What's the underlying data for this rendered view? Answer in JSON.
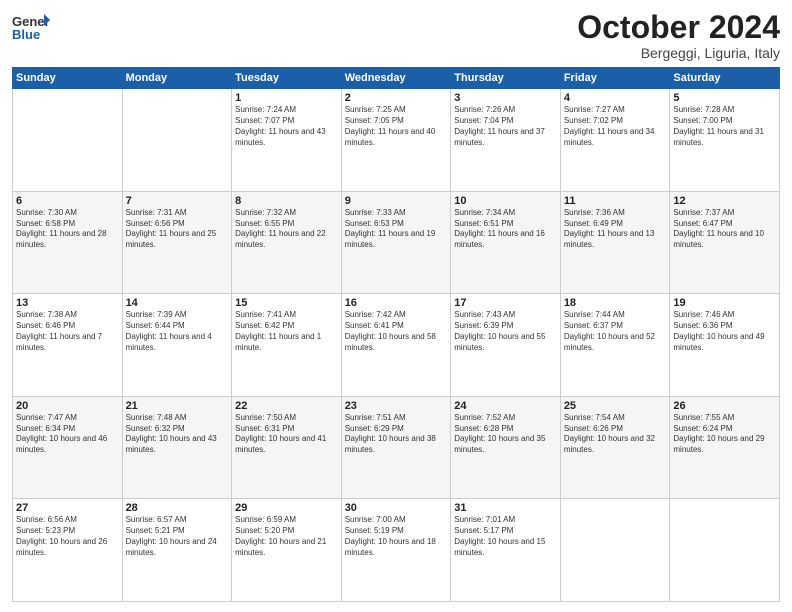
{
  "header": {
    "logo_general": "General",
    "logo_blue": "Blue",
    "month": "October 2024",
    "location": "Bergeggi, Liguria, Italy"
  },
  "weekdays": [
    "Sunday",
    "Monday",
    "Tuesday",
    "Wednesday",
    "Thursday",
    "Friday",
    "Saturday"
  ],
  "weeks": [
    [
      {
        "day": "",
        "sunrise": "",
        "sunset": "",
        "daylight": ""
      },
      {
        "day": "",
        "sunrise": "",
        "sunset": "",
        "daylight": ""
      },
      {
        "day": "1",
        "sunrise": "Sunrise: 7:24 AM",
        "sunset": "Sunset: 7:07 PM",
        "daylight": "Daylight: 11 hours and 43 minutes."
      },
      {
        "day": "2",
        "sunrise": "Sunrise: 7:25 AM",
        "sunset": "Sunset: 7:05 PM",
        "daylight": "Daylight: 11 hours and 40 minutes."
      },
      {
        "day": "3",
        "sunrise": "Sunrise: 7:26 AM",
        "sunset": "Sunset: 7:04 PM",
        "daylight": "Daylight: 11 hours and 37 minutes."
      },
      {
        "day": "4",
        "sunrise": "Sunrise: 7:27 AM",
        "sunset": "Sunset: 7:02 PM",
        "daylight": "Daylight: 11 hours and 34 minutes."
      },
      {
        "day": "5",
        "sunrise": "Sunrise: 7:28 AM",
        "sunset": "Sunset: 7:00 PM",
        "daylight": "Daylight: 11 hours and 31 minutes."
      }
    ],
    [
      {
        "day": "6",
        "sunrise": "Sunrise: 7:30 AM",
        "sunset": "Sunset: 6:58 PM",
        "daylight": "Daylight: 11 hours and 28 minutes."
      },
      {
        "day": "7",
        "sunrise": "Sunrise: 7:31 AM",
        "sunset": "Sunset: 6:56 PM",
        "daylight": "Daylight: 11 hours and 25 minutes."
      },
      {
        "day": "8",
        "sunrise": "Sunrise: 7:32 AM",
        "sunset": "Sunset: 6:55 PM",
        "daylight": "Daylight: 11 hours and 22 minutes."
      },
      {
        "day": "9",
        "sunrise": "Sunrise: 7:33 AM",
        "sunset": "Sunset: 6:53 PM",
        "daylight": "Daylight: 11 hours and 19 minutes."
      },
      {
        "day": "10",
        "sunrise": "Sunrise: 7:34 AM",
        "sunset": "Sunset: 6:51 PM",
        "daylight": "Daylight: 11 hours and 16 minutes."
      },
      {
        "day": "11",
        "sunrise": "Sunrise: 7:36 AM",
        "sunset": "Sunset: 6:49 PM",
        "daylight": "Daylight: 11 hours and 13 minutes."
      },
      {
        "day": "12",
        "sunrise": "Sunrise: 7:37 AM",
        "sunset": "Sunset: 6:47 PM",
        "daylight": "Daylight: 11 hours and 10 minutes."
      }
    ],
    [
      {
        "day": "13",
        "sunrise": "Sunrise: 7:38 AM",
        "sunset": "Sunset: 6:46 PM",
        "daylight": "Daylight: 11 hours and 7 minutes."
      },
      {
        "day": "14",
        "sunrise": "Sunrise: 7:39 AM",
        "sunset": "Sunset: 6:44 PM",
        "daylight": "Daylight: 11 hours and 4 minutes."
      },
      {
        "day": "15",
        "sunrise": "Sunrise: 7:41 AM",
        "sunset": "Sunset: 6:42 PM",
        "daylight": "Daylight: 11 hours and 1 minute."
      },
      {
        "day": "16",
        "sunrise": "Sunrise: 7:42 AM",
        "sunset": "Sunset: 6:41 PM",
        "daylight": "Daylight: 10 hours and 58 minutes."
      },
      {
        "day": "17",
        "sunrise": "Sunrise: 7:43 AM",
        "sunset": "Sunset: 6:39 PM",
        "daylight": "Daylight: 10 hours and 55 minutes."
      },
      {
        "day": "18",
        "sunrise": "Sunrise: 7:44 AM",
        "sunset": "Sunset: 6:37 PM",
        "daylight": "Daylight: 10 hours and 52 minutes."
      },
      {
        "day": "19",
        "sunrise": "Sunrise: 7:46 AM",
        "sunset": "Sunset: 6:36 PM",
        "daylight": "Daylight: 10 hours and 49 minutes."
      }
    ],
    [
      {
        "day": "20",
        "sunrise": "Sunrise: 7:47 AM",
        "sunset": "Sunset: 6:34 PM",
        "daylight": "Daylight: 10 hours and 46 minutes."
      },
      {
        "day": "21",
        "sunrise": "Sunrise: 7:48 AM",
        "sunset": "Sunset: 6:32 PM",
        "daylight": "Daylight: 10 hours and 43 minutes."
      },
      {
        "day": "22",
        "sunrise": "Sunrise: 7:50 AM",
        "sunset": "Sunset: 6:31 PM",
        "daylight": "Daylight: 10 hours and 41 minutes."
      },
      {
        "day": "23",
        "sunrise": "Sunrise: 7:51 AM",
        "sunset": "Sunset: 6:29 PM",
        "daylight": "Daylight: 10 hours and 38 minutes."
      },
      {
        "day": "24",
        "sunrise": "Sunrise: 7:52 AM",
        "sunset": "Sunset: 6:28 PM",
        "daylight": "Daylight: 10 hours and 35 minutes."
      },
      {
        "day": "25",
        "sunrise": "Sunrise: 7:54 AM",
        "sunset": "Sunset: 6:26 PM",
        "daylight": "Daylight: 10 hours and 32 minutes."
      },
      {
        "day": "26",
        "sunrise": "Sunrise: 7:55 AM",
        "sunset": "Sunset: 6:24 PM",
        "daylight": "Daylight: 10 hours and 29 minutes."
      }
    ],
    [
      {
        "day": "27",
        "sunrise": "Sunrise: 6:56 AM",
        "sunset": "Sunset: 5:23 PM",
        "daylight": "Daylight: 10 hours and 26 minutes."
      },
      {
        "day": "28",
        "sunrise": "Sunrise: 6:57 AM",
        "sunset": "Sunset: 5:21 PM",
        "daylight": "Daylight: 10 hours and 24 minutes."
      },
      {
        "day": "29",
        "sunrise": "Sunrise: 6:59 AM",
        "sunset": "Sunset: 5:20 PM",
        "daylight": "Daylight: 10 hours and 21 minutes."
      },
      {
        "day": "30",
        "sunrise": "Sunrise: 7:00 AM",
        "sunset": "Sunset: 5:19 PM",
        "daylight": "Daylight: 10 hours and 18 minutes."
      },
      {
        "day": "31",
        "sunrise": "Sunrise: 7:01 AM",
        "sunset": "Sunset: 5:17 PM",
        "daylight": "Daylight: 10 hours and 15 minutes."
      },
      {
        "day": "",
        "sunrise": "",
        "sunset": "",
        "daylight": ""
      },
      {
        "day": "",
        "sunrise": "",
        "sunset": "",
        "daylight": ""
      }
    ]
  ]
}
